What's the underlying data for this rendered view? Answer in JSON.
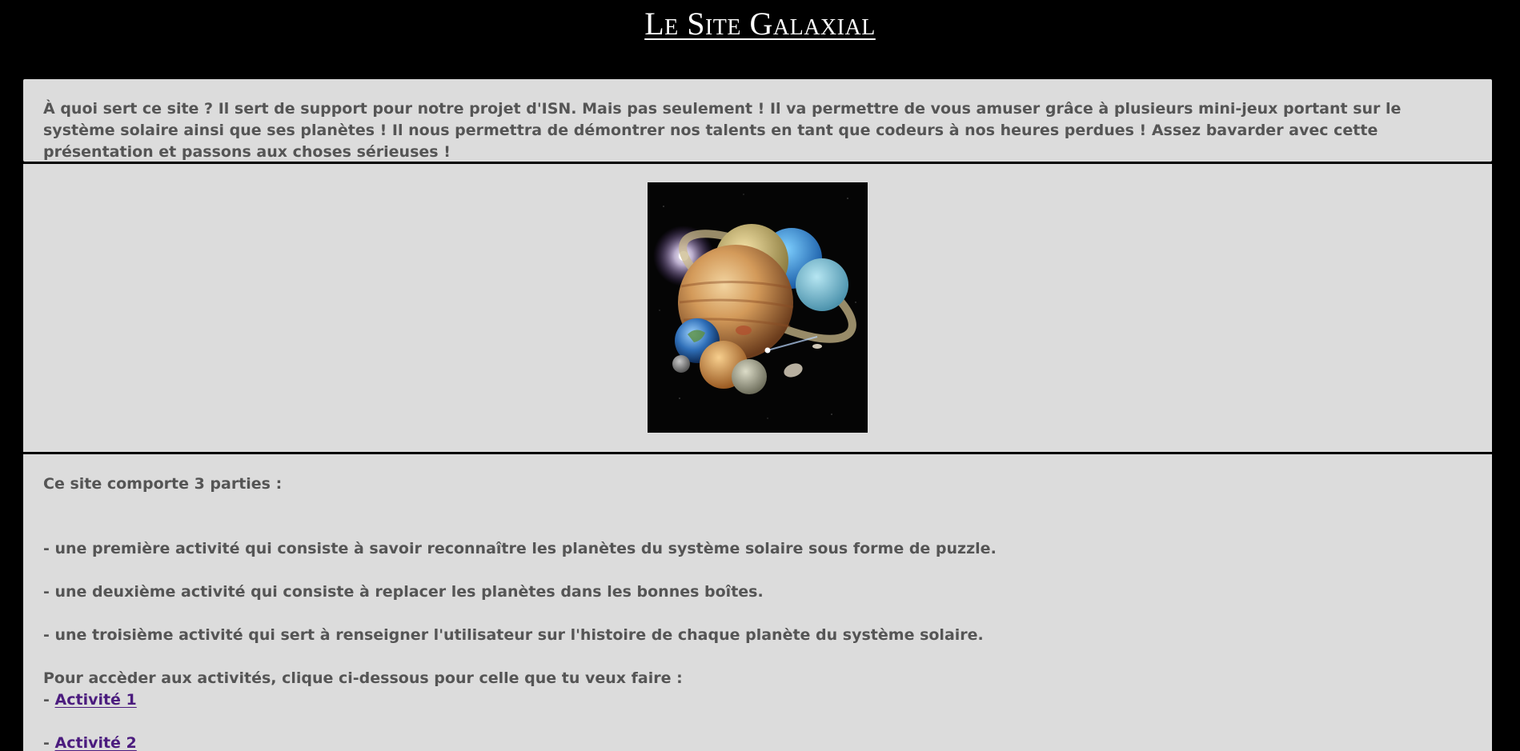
{
  "header": {
    "title": "Le Site Galaxial"
  },
  "intro": {
    "text": "À quoi sert ce site ? Il sert de support pour notre projet d'ISN. Mais pas seulement ! Il va permettre de vous amuser grâce à plusieurs mini-jeux portant sur le système solaire ainsi que ses planètes ! Il nous permettra de démontrer nos talents en tant que codeurs à nos heures perdues ! Assez bavarder avec cette présentation et passons aux choses sérieuses !"
  },
  "image": {
    "icon": "solar-system-planets-image"
  },
  "content": {
    "parts_intro": "Ce site comporte 3 parties :",
    "items": [
      "- une première activité qui consiste à savoir reconnaître les planètes du système solaire sous forme de puzzle.",
      "- une deuxième activité qui consiste à replacer les planètes dans les bonnes boîtes.",
      "- une troisième activité qui sert à renseigner l'utilisateur sur l'histoire de chaque planète du système solaire."
    ],
    "access_text": "Pour accèder aux activités, clique ci-dessous pour celle que tu veux faire :",
    "link_prefix": "- ",
    "links": [
      {
        "label": "Activité 1"
      },
      {
        "label": "Activité 2"
      }
    ]
  },
  "colors": {
    "background": "#000000",
    "panel": "#dcdcdc",
    "text": "#555555",
    "link": "#4b1c7e",
    "title": "#ffffff"
  }
}
